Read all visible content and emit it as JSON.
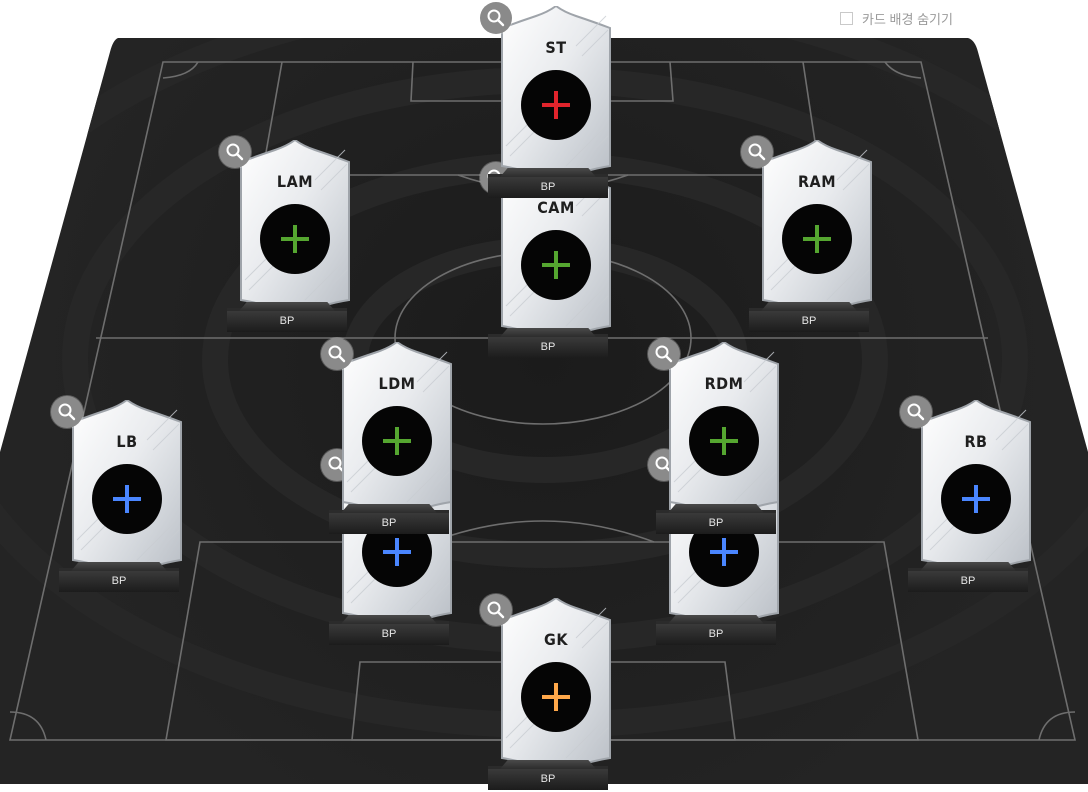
{
  "toggle": {
    "label": "카드 배경 숨기기",
    "checked": false
  },
  "colors": {
    "pitch": "#1f1f1f",
    "lines": "#7a7a7a",
    "forward": "#e0242c",
    "midfield": "#55a630",
    "defense": "#4a86ff",
    "goalkeeper": "#ffa84a"
  },
  "slots": [
    {
      "id": "ldm2",
      "position": "",
      "group": "defense",
      "rating_label": "BP"
    },
    {
      "id": "rdm2",
      "position": "",
      "group": "defense",
      "rating_label": "BP"
    },
    {
      "id": "cam",
      "position": "CAM",
      "group": "midfield",
      "rating_label": "BP"
    },
    {
      "id": "st",
      "position": "ST",
      "group": "forward",
      "rating_label": "BP"
    },
    {
      "id": "lam",
      "position": "LAM",
      "group": "midfield",
      "rating_label": "BP"
    },
    {
      "id": "ram",
      "position": "RAM",
      "group": "midfield",
      "rating_label": "BP"
    },
    {
      "id": "lb",
      "position": "LB",
      "group": "defense",
      "rating_label": "BP"
    },
    {
      "id": "rb",
      "position": "RB",
      "group": "defense",
      "rating_label": "BP"
    },
    {
      "id": "ldm",
      "position": "LDM",
      "group": "midfield",
      "rating_label": "BP"
    },
    {
      "id": "rdm",
      "position": "RDM",
      "group": "midfield",
      "rating_label": "BP"
    },
    {
      "id": "gk",
      "position": "GK",
      "group": "goalkeeper",
      "rating_label": "BP"
    }
  ]
}
